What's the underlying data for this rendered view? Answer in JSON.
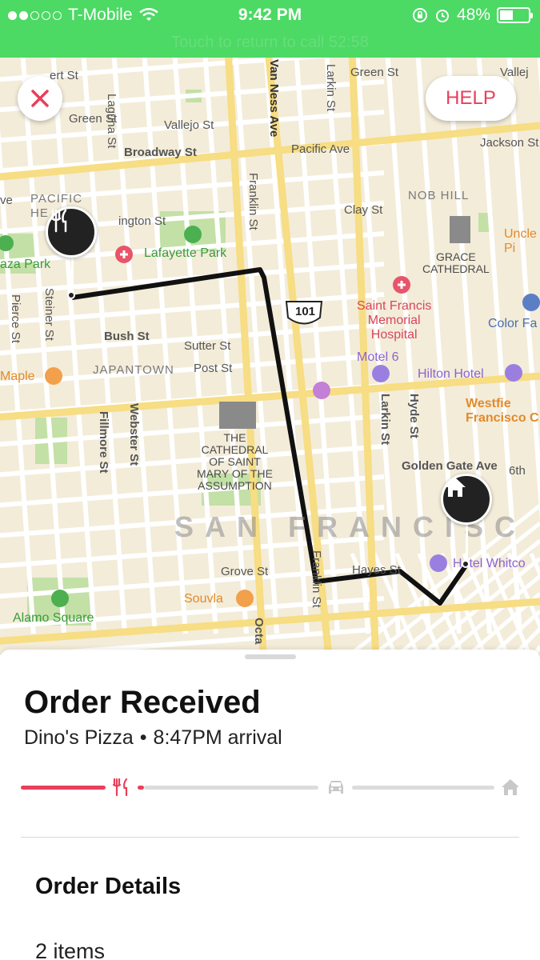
{
  "status_bar": {
    "carrier": "T-Mobile",
    "time": "9:42 PM",
    "battery_percent": "48%",
    "battery_level": 0.48,
    "signal_bars": 2,
    "ghost_text": "Touch to return to call 52:58"
  },
  "map": {
    "close_icon": "close-icon",
    "help_label": "HELP",
    "streets": {
      "green_st_left": "Green St",
      "green_st_right": "Green St",
      "vallejo_st": "Vallejo St",
      "vallejo_right": "Vallej",
      "broadway_st": "Broadway St",
      "pacific_ave": "Pacific Ave",
      "jackson_st": "Jackson St",
      "clay_st": "Clay St",
      "bush_st": "Bush St",
      "sutter_st": "Sutter St",
      "post_st": "Post St",
      "golden_gate_ave": "Golden Gate Ave",
      "grove_st": "Grove St",
      "hayes_st": "Hayes St",
      "laguna_st": "Laguna St",
      "van_ness_ave": "Van Ness Ave",
      "larkin_st_top": "Larkin St",
      "larkin_st": "Larkin St",
      "franklin_st": "Franklin St",
      "franklin_st_bottom": "Franklin St",
      "hyde_st": "Hyde St",
      "fillmore_st": "Fillmore St",
      "webster_st": "Webster St",
      "steiner_st": "Steiner St",
      "pierce_st": "Pierce St",
      "octavia": "Octa",
      "sixth_st": "6th",
      "ert_st": "ert St",
      "ve": "ve",
      "highway": "101"
    },
    "neighborhoods": {
      "pacific_heights": "PACIFIC\nHE",
      "nob_hill": "NOB HILL",
      "japantown": "JAPANTOWN",
      "city": "SAN FRANCISC"
    },
    "places": {
      "lafayette_park": "Lafayette Park",
      "alta_plaza": "aza Park",
      "alamo_square": "Alamo Square",
      "grace_cathedral": "GRACE\nCATHEDRAL",
      "cathedral_st_mary": "THE\nCATHEDRAL\nOF SAINT\nMARY OF THE\nASSUMPTION",
      "st_francis": "Saint Francis\nMemorial\nHospital",
      "motel_6": "Motel 6",
      "hilton": "Hilton Hotel",
      "hotel_whitcomb": "Hotel Whitco",
      "maple": "Maple",
      "souvla": "Souvla",
      "uncle": "Uncle\nPi",
      "color_factory": "Color Fa",
      "westfield": "Westfie\nFrancisco C",
      "washington_st": "ington St"
    },
    "pins": {
      "restaurant_icon": "fork-knife-icon",
      "home_icon": "home-icon"
    }
  },
  "order": {
    "status_title": "Order Received",
    "restaurant": "Dino's Pizza",
    "separator": "•",
    "arrival": "8:47PM arrival",
    "progress": {
      "stage": "received",
      "icons": [
        "fork-knife-icon",
        "car-icon",
        "home-icon"
      ],
      "active_color": "#e83f5b",
      "inactive_color": "#dcdcdc"
    },
    "details_title": "Order Details",
    "items_count": "2 items"
  },
  "colors": {
    "status_bar": "#4cd964",
    "accent": "#e83f5b",
    "map_bg": "#f3ecd9",
    "route": "#111111"
  }
}
